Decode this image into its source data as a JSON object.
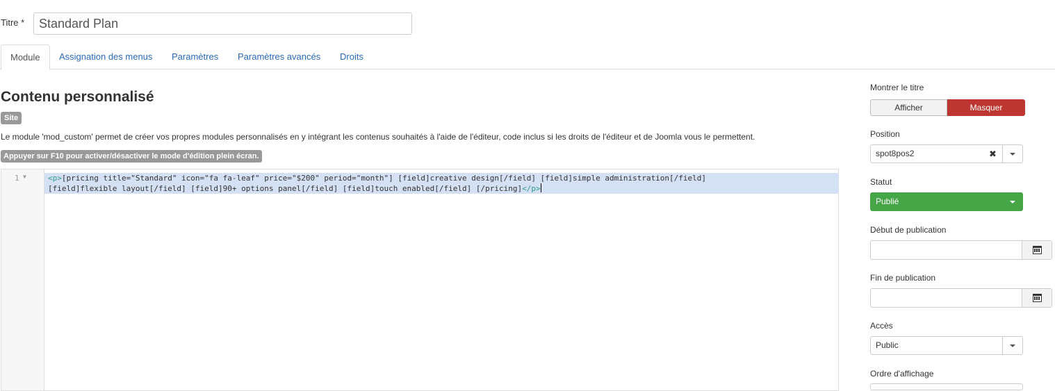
{
  "form": {
    "title_label": "Titre *",
    "title_value": "Standard Plan"
  },
  "tabs": [
    {
      "label": "Module"
    },
    {
      "label": "Assignation des menus"
    },
    {
      "label": "Paramètres"
    },
    {
      "label": "Paramètres avancés"
    },
    {
      "label": "Droits"
    }
  ],
  "module": {
    "heading": "Contenu personnalisé",
    "site_badge": "Site",
    "description": "Le module 'mod_custom' permet de créer vos propres modules personnalisés en y intégrant les contenus souhaités à l'aide de l'éditeur, code inclus si les droits de l'éditeur et de Joomla vous le permettent.",
    "fullscreen_hint": "Appuyer sur F10 pour activer/désactiver le mode d'édition plein écran."
  },
  "editor": {
    "line_number": "1",
    "open_tag": "<p>",
    "line1_text": "[pricing title=\"Standard\" icon=\"fa fa-leaf\" price=\"$200\" period=\"month\"] [field]creative design[/field] [field]simple administration[/field]",
    "line2_text": "[field]flexible layout[/field] [field]90+ options panel[/field] [field]touch enabled[/field] [/pricing]",
    "close_tag": "</p>"
  },
  "sidebar": {
    "show_title_label": "Montrer le titre",
    "show_btn": "Afficher",
    "hide_btn": "Masquer",
    "position_label": "Position",
    "position_value": "spot8pos2",
    "status_label": "Statut",
    "status_value": "Publié",
    "publish_up_label": "Début de publication",
    "publish_down_label": "Fin de publication",
    "access_label": "Accès",
    "access_value": "Public",
    "ordering_label": "Ordre d'affichage"
  },
  "colors": {
    "link": "#2a69b8",
    "danger": "#bd362f",
    "success": "#46a546",
    "selection": "#d4e1f5",
    "code_tag": "#2f9a8f"
  }
}
